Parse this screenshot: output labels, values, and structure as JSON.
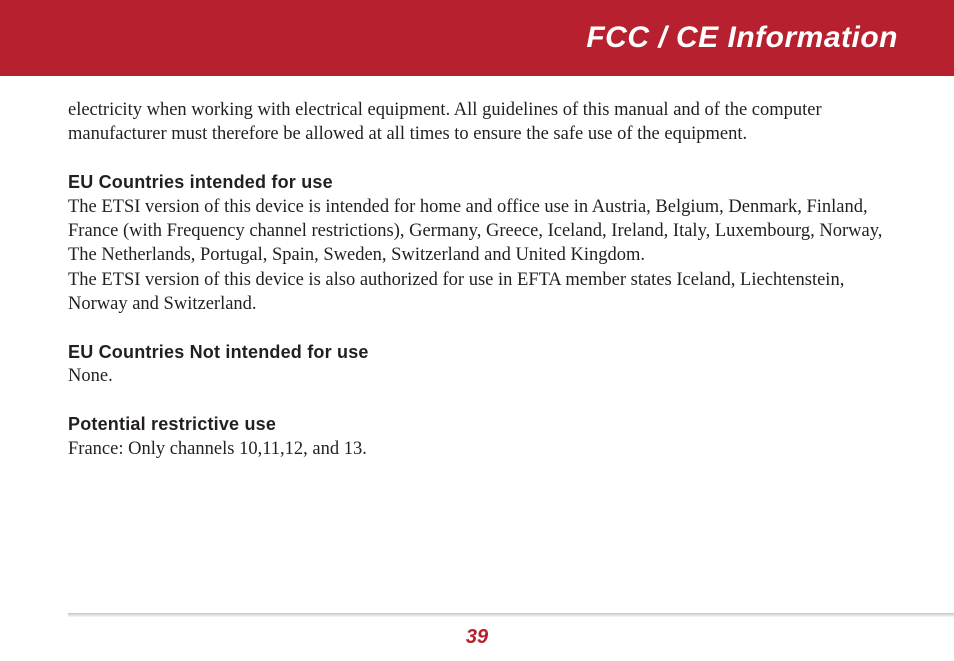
{
  "header": {
    "title": "FCC / CE Information"
  },
  "body": {
    "intro_continuation": "electricity when working with electrical equipment. All guidelines of this manual and of the computer manufacturer must therefore be allowed at all times to ensure the safe use of the equipment.",
    "sections": {
      "eu_intended": {
        "heading": "EU Countries intended for use",
        "para1": "The ETSI version of this device is intended for home and office use in Austria, Belgium, Denmark, Finland, France (with Frequency channel restrictions), Germany, Greece, Iceland, Ireland, Italy, Luxembourg, Norway, The Netherlands, Portugal, Spain, Sweden, Switzerland and United Kingdom.",
        "para2": "The ETSI version of this device is also authorized for use in EFTA member states Iceland, Liechtenstein, Norway and Switzerland."
      },
      "eu_not_intended": {
        "heading": "EU Countries Not intended for use",
        "body": "None."
      },
      "restrictive": {
        "heading": "Potential restrictive use",
        "body": "France: Only channels 10,11,12, and 13."
      }
    }
  },
  "page_number": "39",
  "colors": {
    "brand_red": "#b7202e",
    "text": "#231f20"
  }
}
